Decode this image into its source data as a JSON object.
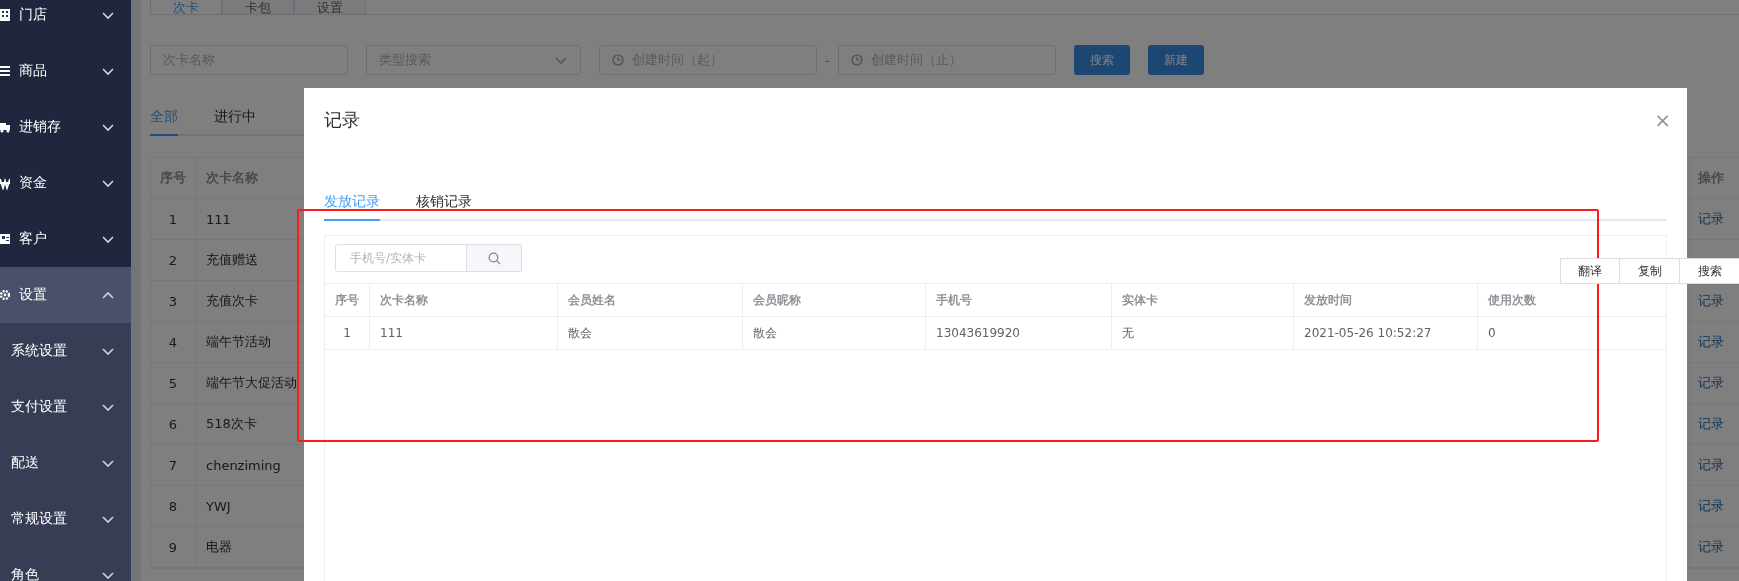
{
  "sidebar": {
    "items": [
      {
        "label": "门店",
        "expanded": false,
        "selected": false
      },
      {
        "label": "商品",
        "expanded": false,
        "selected": false
      },
      {
        "label": "进销存",
        "expanded": false,
        "selected": false
      },
      {
        "label": "资金",
        "expanded": false,
        "selected": false
      },
      {
        "label": "客户",
        "expanded": false,
        "selected": false
      },
      {
        "label": "设置",
        "expanded": true,
        "selected": true,
        "children": [
          {
            "label": "系统设置",
            "expanded": false
          },
          {
            "label": "支付设置",
            "expanded": false
          },
          {
            "label": "配送",
            "expanded": false
          },
          {
            "label": "常规设置",
            "expanded": false
          },
          {
            "label": "角色",
            "expanded": false
          }
        ]
      }
    ]
  },
  "page": {
    "tabs": [
      {
        "label": "次卡",
        "selected": true
      },
      {
        "label": "卡包",
        "selected": false
      },
      {
        "label": "设置",
        "selected": false
      }
    ],
    "filters": {
      "name_placeholder": "次卡名称",
      "type_placeholder": "类型搜索",
      "start_placeholder": "创建时间（起）",
      "separator": "-",
      "end_placeholder": "创建时间（止）",
      "buttons": [
        "搜索",
        "新建"
      ]
    },
    "status_tabs": [
      {
        "label": "全部",
        "selected": true
      },
      {
        "label": "进行中",
        "selected": false
      }
    ],
    "table": {
      "columns": [
        "序号",
        "次卡名称"
      ],
      "action_column": "操作",
      "rows": [
        {
          "index": "1",
          "name": "111",
          "action": "记录"
        },
        {
          "index": "2",
          "name": "充值赠送"
        },
        {
          "index": "3",
          "name": "充值次卡",
          "action": "记录"
        },
        {
          "index": "4",
          "name": "端午节活动",
          "action": "记录"
        },
        {
          "index": "5",
          "name": "端午节大促活动",
          "action": "记录"
        },
        {
          "index": "6",
          "name": "518次卡",
          "action": "记录"
        },
        {
          "index": "7",
          "name": "chenziming",
          "action": "记录"
        },
        {
          "index": "8",
          "name": "YWJ",
          "action": "记录"
        },
        {
          "index": "9",
          "name": "电器",
          "action": "记录"
        }
      ]
    }
  },
  "modal": {
    "title": "记录",
    "close": "×",
    "tabs": [
      {
        "label": "发放记录",
        "selected": true
      },
      {
        "label": "核销记录",
        "selected": false
      }
    ],
    "search": {
      "placeholder": "手机号/实体卡"
    },
    "table": {
      "columns": [
        "序号",
        "次卡名称",
        "会员姓名",
        "会员昵称",
        "手机号",
        "实体卡",
        "发放时间",
        "使用次数"
      ],
      "rows": [
        [
          "1",
          "111",
          "散会",
          "散会",
          "13043619920",
          "无",
          "2021-05-26 10:52:27",
          "0"
        ]
      ]
    }
  },
  "context_toolbar": {
    "items": [
      "翻译",
      "复制",
      "搜索"
    ]
  }
}
